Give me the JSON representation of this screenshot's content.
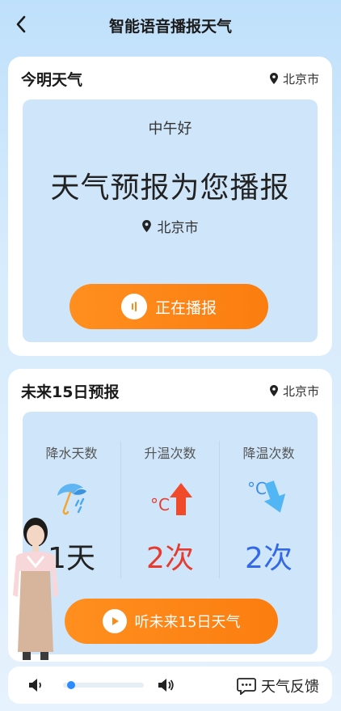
{
  "header": {
    "title": "智能语音播报天气"
  },
  "today_card": {
    "title": "今明天气",
    "location": "北京市",
    "greeting": "中午好",
    "headline": "天气预报为您播报",
    "inner_location": "北京市",
    "broadcast_button": "正在播报"
  },
  "forecast_card": {
    "title": "未来15日预报",
    "location": "北京市",
    "stats": [
      {
        "label": "降水天数",
        "value": "1天",
        "icon": "umbrella-rain-icon"
      },
      {
        "label": "升温次数",
        "value": "2次",
        "icon": "temperature-up-icon"
      },
      {
        "label": "降温次数",
        "value": "2次",
        "icon": "temperature-down-icon"
      }
    ],
    "listen_button": "听未来15日天气"
  },
  "bottom_bar": {
    "volume_level": 0.05,
    "feedback_label": "天气反馈"
  },
  "colors": {
    "accent_orange": "#fb8a18",
    "rise_red": "#e63b2e",
    "fall_blue": "#3469e6",
    "panel_blue": "#cfe6fa"
  }
}
